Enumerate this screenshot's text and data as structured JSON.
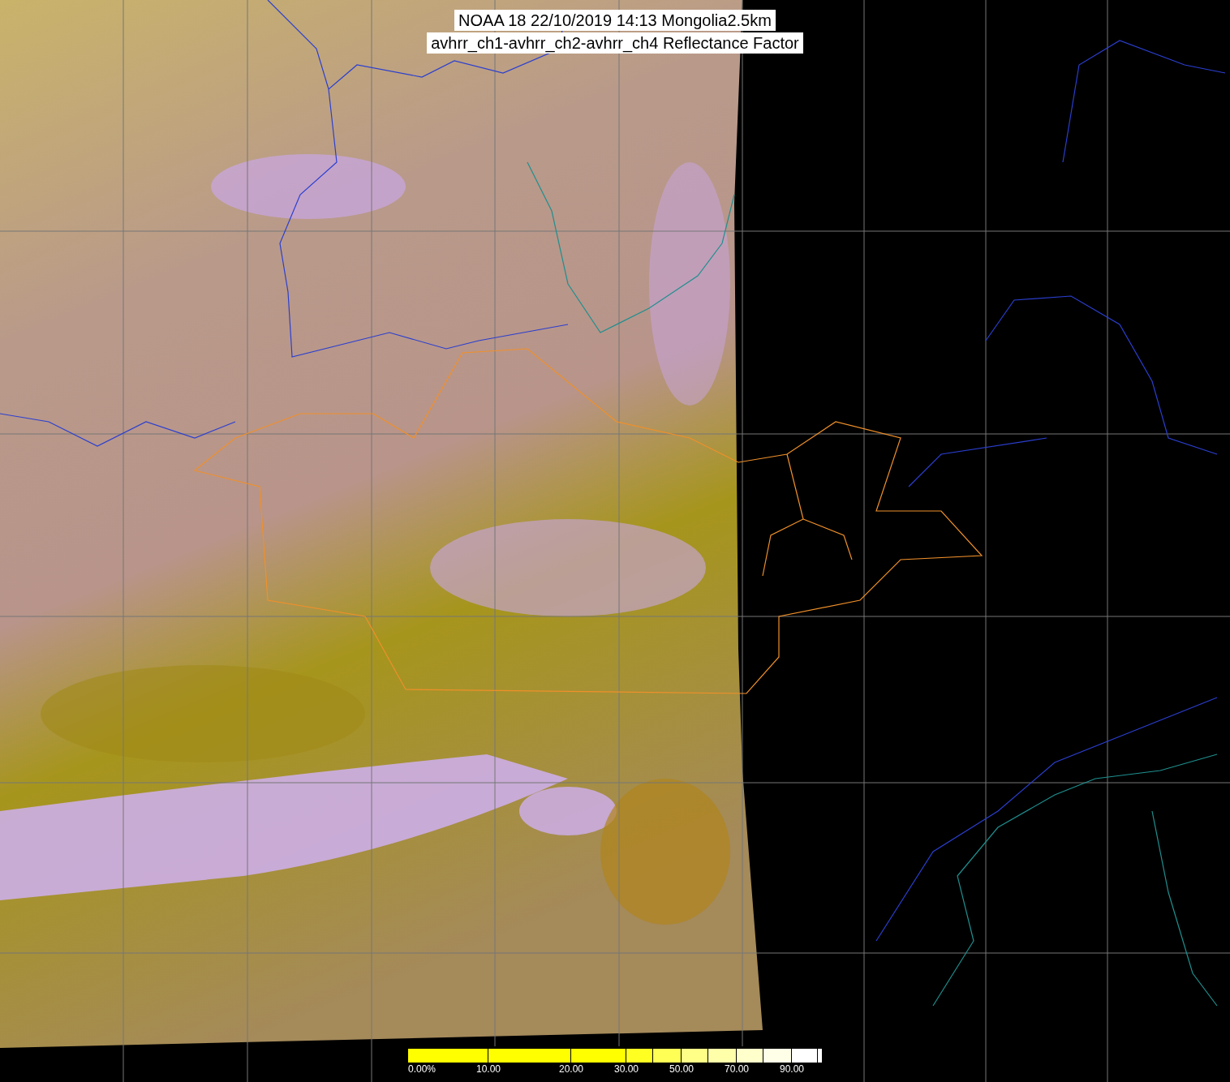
{
  "title_lines": [
    "NOAA 18 22/10/2019 14:13 Mongolia2.5km",
    "avhrr_ch1-avhrr_ch2-avhrr_ch4 Reflectance Factor"
  ],
  "colorbar": {
    "segments": [
      {
        "color": "#ffff00",
        "label": "0.00%"
      },
      {
        "color": "#ffff00",
        "label": "10.00"
      },
      {
        "color": "#ffff00",
        "label": "20.00"
      },
      {
        "color": "#ffff22",
        "label": "30.00"
      },
      {
        "color": "#ffff55"
      },
      {
        "color": "#ffff88",
        "label": "50.00"
      },
      {
        "color": "#ffffaa"
      },
      {
        "color": "#ffffcc",
        "label": "70.00"
      },
      {
        "color": "#ffffe8"
      },
      {
        "color": "#ffffff",
        "label": "90.00"
      },
      {
        "color": "#ffffff"
      }
    ]
  }
}
